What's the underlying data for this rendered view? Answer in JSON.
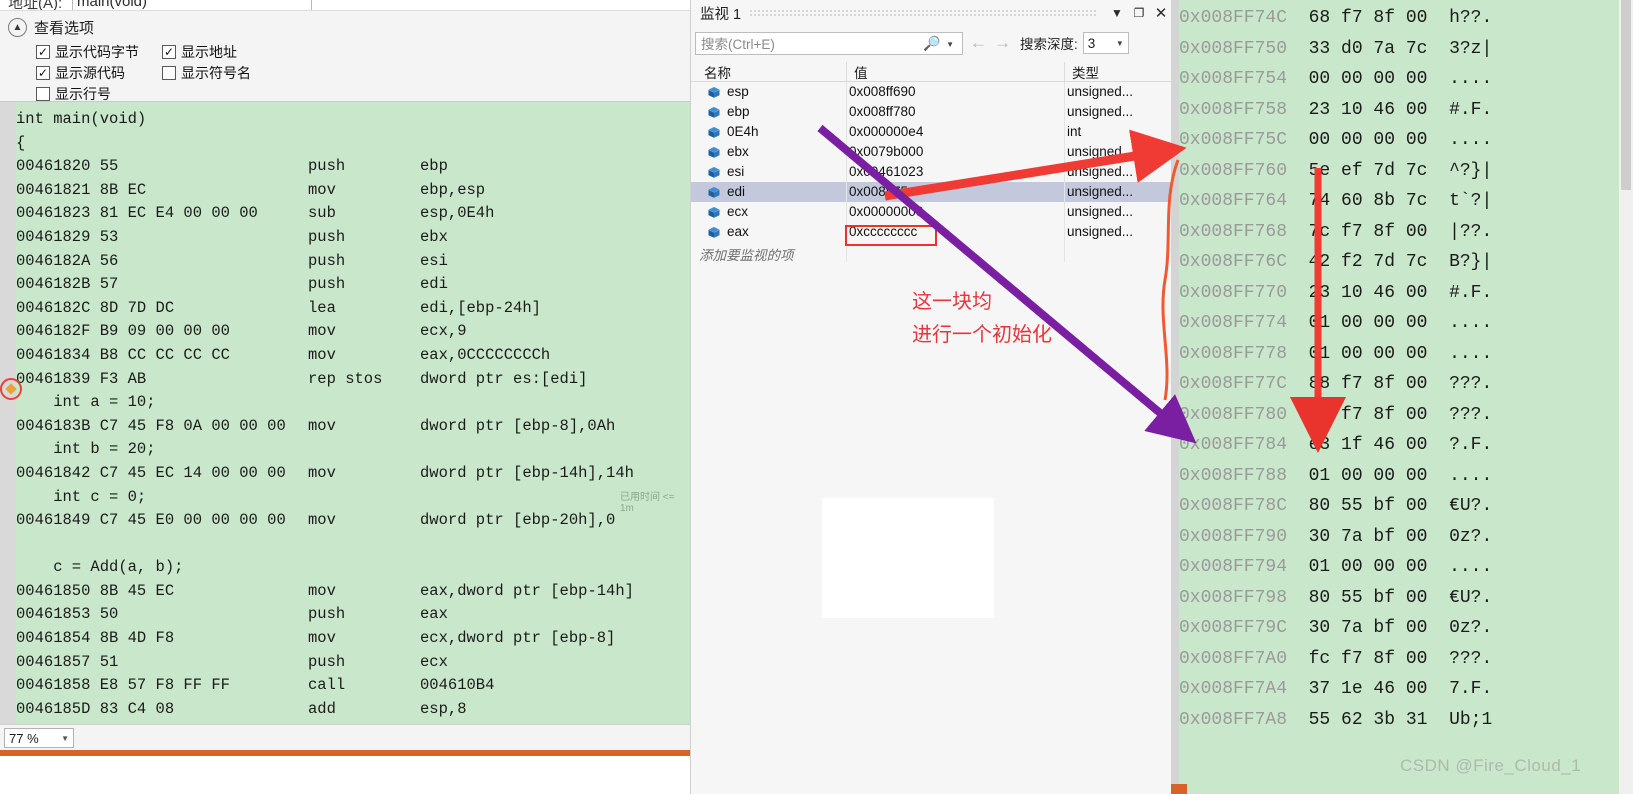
{
  "address_bar": {
    "label": "地址(A):",
    "value": "main(void)"
  },
  "view_options": {
    "title": "查看选项",
    "collapse_icon": "chevron-up-icon",
    "options": [
      {
        "label": "显示代码字节",
        "checked": true
      },
      {
        "label": "显示地址",
        "checked": true
      },
      {
        "label": "显示源代码",
        "checked": true
      },
      {
        "label": "显示符号名",
        "checked": false
      },
      {
        "label": "显示行号",
        "checked": false
      }
    ]
  },
  "disassembly": {
    "elapsed_label": "已用时间 <= 1m",
    "lines": [
      {
        "type": "src",
        "text": "int main(void)"
      },
      {
        "type": "src",
        "text": "{"
      },
      {
        "type": "asm",
        "addr": "00461820",
        "bytes": "55",
        "mnem": "push",
        "oper": "ebp"
      },
      {
        "type": "asm",
        "addr": "00461821",
        "bytes": "8B EC",
        "mnem": "mov",
        "oper": "ebp,esp"
      },
      {
        "type": "asm",
        "addr": "00461823",
        "bytes": "81 EC E4 00 00 00",
        "mnem": "sub",
        "oper": "esp,0E4h"
      },
      {
        "type": "asm",
        "addr": "00461829",
        "bytes": "53",
        "mnem": "push",
        "oper": "ebx"
      },
      {
        "type": "asm",
        "addr": "0046182A",
        "bytes": "56",
        "mnem": "push",
        "oper": "esi"
      },
      {
        "type": "asm",
        "addr": "0046182B",
        "bytes": "57",
        "mnem": "push",
        "oper": "edi"
      },
      {
        "type": "asm",
        "addr": "0046182C",
        "bytes": "8D 7D DC",
        "mnem": "lea",
        "oper": "edi,[ebp-24h]"
      },
      {
        "type": "asm",
        "addr": "0046182F",
        "bytes": "B9 09 00 00 00",
        "mnem": "mov",
        "oper": "ecx,9"
      },
      {
        "type": "asm",
        "addr": "00461834",
        "bytes": "B8 CC CC CC CC",
        "mnem": "mov",
        "oper": "eax,0CCCCCCCCh"
      },
      {
        "type": "asm",
        "addr": "00461839",
        "bytes": "F3 AB",
        "mnem": "rep stos",
        "oper": "dword ptr es:[edi]",
        "current": true
      },
      {
        "type": "src",
        "text": "    int a = 10;"
      },
      {
        "type": "asm",
        "addr": "0046183B",
        "bytes": "C7 45 F8 0A 00 00 00",
        "mnem": "mov",
        "oper": "dword ptr [ebp-8],0Ah"
      },
      {
        "type": "src",
        "text": "    int b = 20;"
      },
      {
        "type": "asm",
        "addr": "00461842",
        "bytes": "C7 45 EC 14 00 00 00",
        "mnem": "mov",
        "oper": "dword ptr [ebp-14h],14h"
      },
      {
        "type": "src",
        "text": "    int c = 0;"
      },
      {
        "type": "asm",
        "addr": "00461849",
        "bytes": "C7 45 E0 00 00 00 00",
        "mnem": "mov",
        "oper": "dword ptr [ebp-20h],0"
      },
      {
        "type": "src",
        "text": ""
      },
      {
        "type": "src",
        "text": "    c = Add(a, b);"
      },
      {
        "type": "asm",
        "addr": "00461850",
        "bytes": "8B 45 EC",
        "mnem": "mov",
        "oper": "eax,dword ptr [ebp-14h]"
      },
      {
        "type": "asm",
        "addr": "00461853",
        "bytes": "50",
        "mnem": "push",
        "oper": "eax"
      },
      {
        "type": "asm",
        "addr": "00461854",
        "bytes": "8B 4D F8",
        "mnem": "mov",
        "oper": "ecx,dword ptr [ebp-8]"
      },
      {
        "type": "asm",
        "addr": "00461857",
        "bytes": "51",
        "mnem": "push",
        "oper": "ecx"
      },
      {
        "type": "asm",
        "addr": "00461858",
        "bytes": "E8 57 F8 FF FF",
        "mnem": "call",
        "oper": "004610B4"
      },
      {
        "type": "asm",
        "addr": "0046185D",
        "bytes": "83 C4 08",
        "mnem": "add",
        "oper": "esp,8"
      }
    ]
  },
  "zoom": {
    "value": "77 %"
  },
  "watch": {
    "title": "监视 1",
    "window_buttons": [
      "chevron-down-icon",
      "restore-icon",
      "close-icon"
    ],
    "search": {
      "placeholder": "搜索(Ctrl+E)",
      "value": ""
    },
    "search_icon": "magnifier-icon",
    "nav_back_icon": "arrow-left-icon",
    "nav_forward_icon": "arrow-right-icon",
    "depth_label": "搜索深度:",
    "depth_value": "3",
    "columns": [
      "名称",
      "值",
      "类型"
    ],
    "rows": [
      {
        "name": "esp",
        "value": "0x008ff690",
        "type": "unsigned...",
        "selected": false,
        "boxed": false
      },
      {
        "name": "ebp",
        "value": "0x008ff780",
        "type": "unsigned...",
        "selected": false,
        "boxed": false
      },
      {
        "name": "0E4h",
        "value": "0x000000e4",
        "type": "int",
        "selected": false,
        "boxed": false
      },
      {
        "name": "ebx",
        "value": "0x0079b000",
        "type": "unsigned",
        "selected": false,
        "boxed": false
      },
      {
        "name": "esi",
        "value": "0x00461023",
        "type": "unsigned...",
        "selected": false,
        "boxed": false
      },
      {
        "name": "edi",
        "value": "0x008ff75c",
        "type": "unsigned...",
        "selected": true,
        "boxed": false
      },
      {
        "name": "ecx",
        "value": "0x00000009",
        "type": "unsigned...",
        "selected": false,
        "boxed": false
      },
      {
        "name": "eax",
        "value": "0xcccccccc",
        "type": "unsigned...",
        "selected": false,
        "boxed": true
      }
    ],
    "add_row_placeholder": "添加要监视的项"
  },
  "annotation": {
    "text": "这一块均\n进行一个初始化",
    "color": "#e8343c"
  },
  "memory": {
    "rows": [
      {
        "addr": "0x008FF74C",
        "hex": "68 f7 8f 00",
        "ascii": "h??."
      },
      {
        "addr": "0x008FF750",
        "hex": "33 d0 7a 7c",
        "ascii": "3?z|"
      },
      {
        "addr": "0x008FF754",
        "hex": "00 00 00 00",
        "ascii": "...."
      },
      {
        "addr": "0x008FF758",
        "hex": "23 10 46 00",
        "ascii": "#.F."
      },
      {
        "addr": "0x008FF75C",
        "hex": "00 00 00 00",
        "ascii": "...."
      },
      {
        "addr": "0x008FF760",
        "hex": "5e ef 7d 7c",
        "ascii": "^?}|"
      },
      {
        "addr": "0x008FF764",
        "hex": "74 60 8b 7c",
        "ascii": "t`?|"
      },
      {
        "addr": "0x008FF768",
        "hex": "7c f7 8f 00",
        "ascii": "|??."
      },
      {
        "addr": "0x008FF76C",
        "hex": "42 f2 7d 7c",
        "ascii": "B?}|"
      },
      {
        "addr": "0x008FF770",
        "hex": "23 10 46 00",
        "ascii": "#.F."
      },
      {
        "addr": "0x008FF774",
        "hex": "01 00 00 00",
        "ascii": "...."
      },
      {
        "addr": "0x008FF778",
        "hex": "01 00 00 00",
        "ascii": "...."
      },
      {
        "addr": "0x008FF77C",
        "hex": "88 f7 8f 00",
        "ascii": "???."
      },
      {
        "addr": "0x008FF780",
        "hex": "a0 f7 8f 00",
        "ascii": "???."
      },
      {
        "addr": "0x008FF784",
        "hex": "e3 1f 46 00",
        "ascii": "?.F."
      },
      {
        "addr": "0x008FF788",
        "hex": "01 00 00 00",
        "ascii": "...."
      },
      {
        "addr": "0x008FF78C",
        "hex": "80 55 bf 00",
        "ascii": "€U?."
      },
      {
        "addr": "0x008FF790",
        "hex": "30 7a bf 00",
        "ascii": "0z?."
      },
      {
        "addr": "0x008FF794",
        "hex": "01 00 00 00",
        "ascii": "...."
      },
      {
        "addr": "0x008FF798",
        "hex": "80 55 bf 00",
        "ascii": "€U?."
      },
      {
        "addr": "0x008FF79C",
        "hex": "30 7a bf 00",
        "ascii": "0z?."
      },
      {
        "addr": "0x008FF7A0",
        "hex": "fc f7 8f 00",
        "ascii": "???."
      },
      {
        "addr": "0x008FF7A4",
        "hex": "37 1e 46 00",
        "ascii": "7.F."
      },
      {
        "addr": "0x008FF7A8",
        "hex": "55 62 3b 31",
        "ascii": "Ub;1"
      }
    ]
  },
  "watermark": {
    "text": "CSDN @Fire_Cloud_1"
  },
  "colors": {
    "code_background": "#c9e7cb",
    "annotation_red": "#e8343c",
    "arrow_purple": "#7b1fa2",
    "arrow_red": "#ef3b33",
    "selection": "#c3c8dd"
  }
}
